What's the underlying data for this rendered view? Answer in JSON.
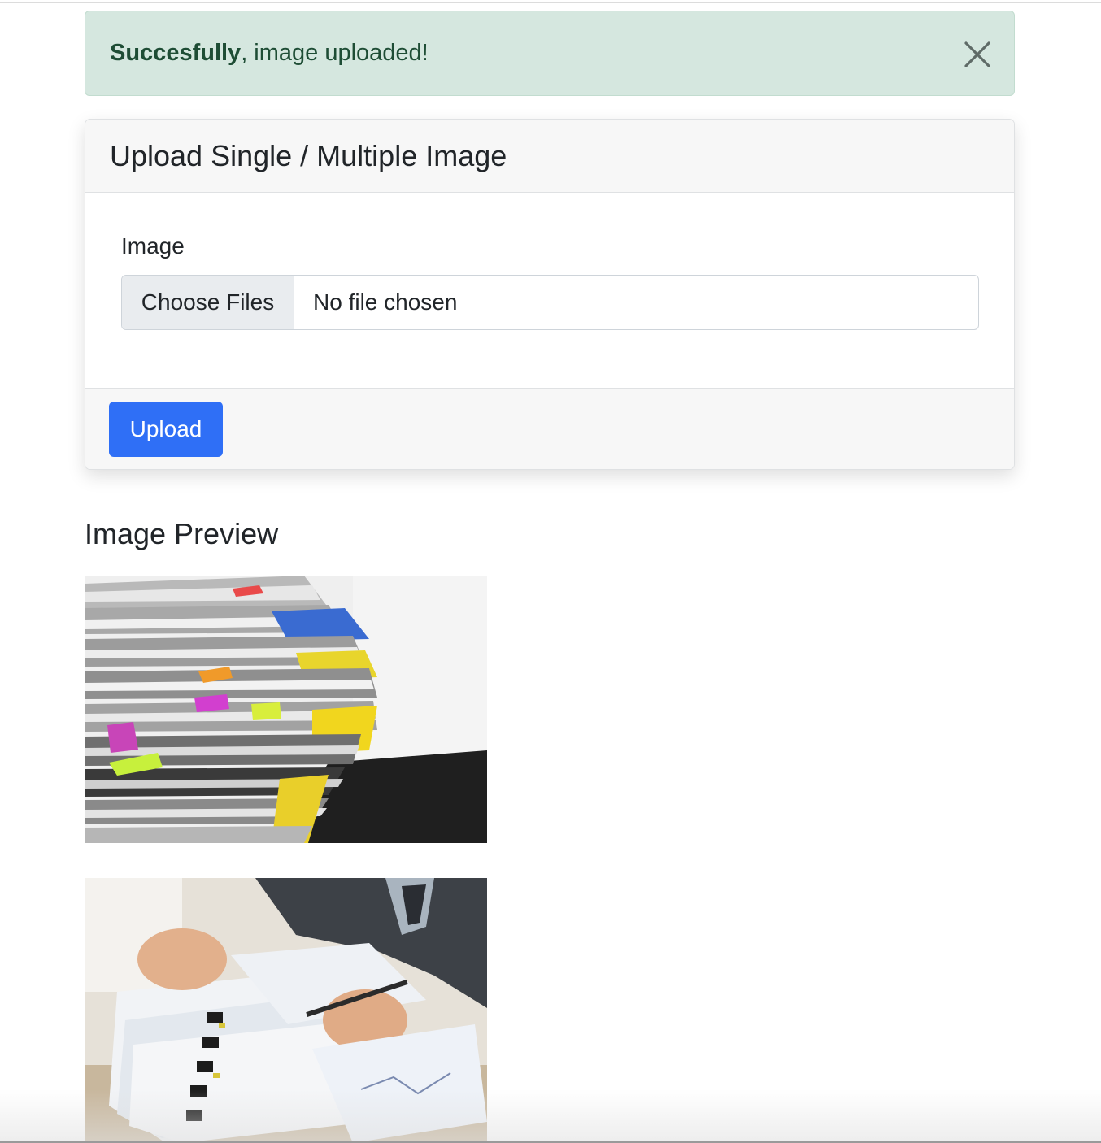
{
  "alert": {
    "strong": "Succesfully",
    "message": ", image uploaded!",
    "close_icon": "close-icon",
    "color": "#d5e7df"
  },
  "card": {
    "title": "Upload Single / Multiple Image",
    "field_label": "Image",
    "file_button": "Choose Files",
    "file_status": "No file chosen",
    "upload_label": "Upload",
    "accent": "#2f6ff6"
  },
  "preview": {
    "title": "Image Preview",
    "images": [
      "stacked-files-photo",
      "person-sorting-documents-photo"
    ]
  }
}
